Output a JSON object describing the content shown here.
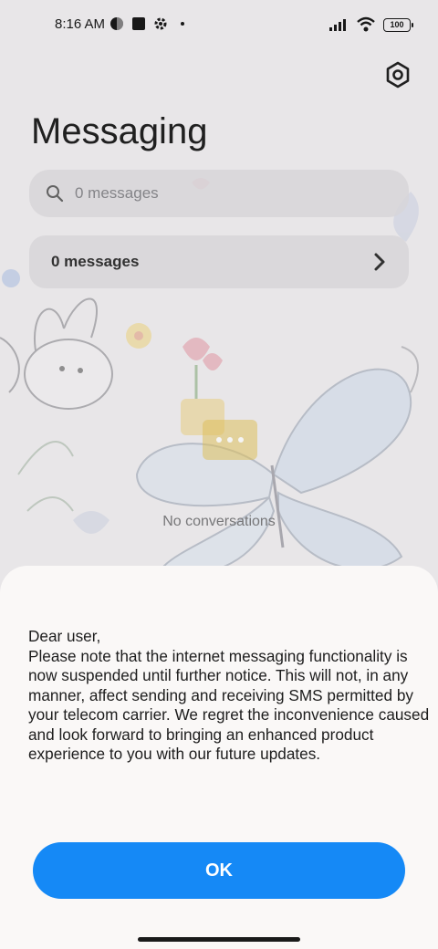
{
  "status_bar": {
    "time": "8:16 AM",
    "battery": "100"
  },
  "header": {
    "title": "Messaging"
  },
  "search": {
    "placeholder": "0 messages"
  },
  "summary": {
    "label": "0 messages"
  },
  "empty_state": {
    "text": "No conversations"
  },
  "dialog": {
    "message": "Dear user,\nPlease note that the internet messaging functionality is now suspended until further notice. This will not, in any manner, affect sending and receiving SMS permitted by your telecom carrier. We regret the inconvenience caused and look forward to bringing an enhanced product experience to you with our future updates.",
    "ok_label": "OK"
  },
  "colors": {
    "accent": "#1589f6",
    "sheet_background": "#faf8f7"
  },
  "icons": {
    "settings": "hexagon-gear-icon",
    "search": "search-icon",
    "chevron": "chevron-right-icon",
    "empty": "chat-bubble-icon"
  }
}
